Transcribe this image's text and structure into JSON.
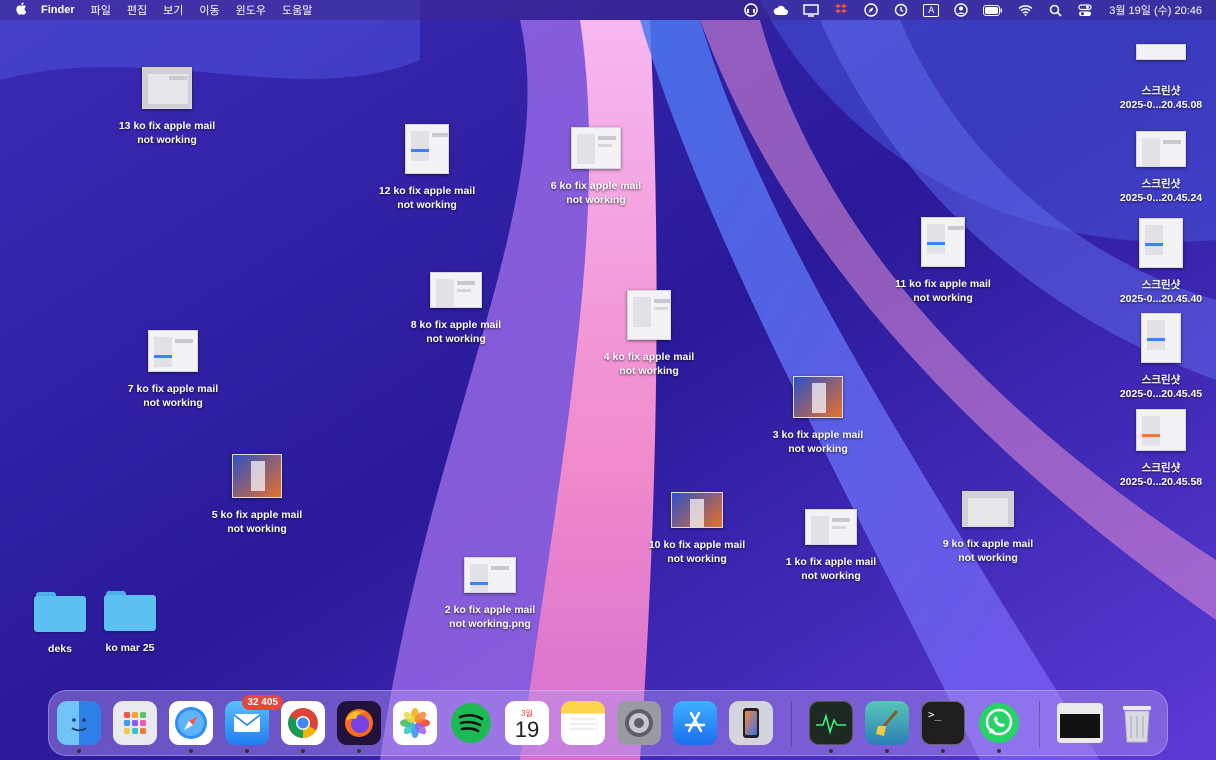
{
  "menubar": {
    "apple": "",
    "app_name": "Finder",
    "menus": [
      "파일",
      "편집",
      "보기",
      "이동",
      "윈도우",
      "도움말"
    ],
    "status_icons": [
      "headset-icon",
      "cloud-icon",
      "display-icon",
      "dropbox-icon",
      "compass-icon",
      "time-machine-icon",
      "input-source-icon",
      "user-icon",
      "battery-icon",
      "wifi-icon",
      "search-icon",
      "control-center-icon"
    ],
    "input_source": "A",
    "clock": "3월 19일 (수) 20:46"
  },
  "desktop": {
    "icons": [
      {
        "line1": "13 ko fix apple mail",
        "line2": "not working"
      },
      {
        "line1": "12 ko fix apple mail",
        "line2": "not working"
      },
      {
        "line1": "6 ko fix apple mail",
        "line2": "not working"
      },
      {
        "line1": "11 ko fix apple mail",
        "line2": "not working"
      },
      {
        "line1": "8 ko fix apple mail",
        "line2": "not working"
      },
      {
        "line1": "4 ko fix apple mail",
        "line2": "not working"
      },
      {
        "line1": "7 ko fix apple mail",
        "line2": "not working"
      },
      {
        "line1": "3 ko fix apple mail",
        "line2": "not working"
      },
      {
        "line1": "5 ko fix apple mail",
        "line2": "not working"
      },
      {
        "line1": "10 ko fix apple mail",
        "line2": "not working"
      },
      {
        "line1": "1 ko fix apple mail",
        "line2": "not working"
      },
      {
        "line1": "9 ko fix apple mail",
        "line2": "not working"
      },
      {
        "line1": "2 ko fix apple mail",
        "line2": "not working.png"
      }
    ],
    "screenshots": [
      {
        "line1": "스크린샷",
        "line2": "2025-0...20.45.08"
      },
      {
        "line1": "스크린샷",
        "line2": "2025-0...20.45.24"
      },
      {
        "line1": "스크린샷",
        "line2": "2025-0...20.45.40"
      },
      {
        "line1": "스크린샷",
        "line2": "2025-0...20.45.45"
      },
      {
        "line1": "스크린샷",
        "line2": "2025-0...20.45.58"
      }
    ],
    "folders": [
      {
        "label": "deks"
      },
      {
        "label": "ko mar 25"
      }
    ]
  },
  "dock": {
    "apps": [
      {
        "name": "finder-icon",
        "color": "#3a8ef0",
        "glyph": "☺",
        "running": true
      },
      {
        "name": "launchpad-icon",
        "color": "#e6e6ee",
        "glyph": "▦",
        "running": false
      },
      {
        "name": "safari-icon",
        "color": "#2f8ff5",
        "glyph": "⊘",
        "running": true
      },
      {
        "name": "mail-icon",
        "color": "#3da0f5",
        "glyph": "✉",
        "running": true
      },
      {
        "name": "chrome-icon",
        "color": "#ffffff",
        "glyph": "◉",
        "running": true
      },
      {
        "name": "firefox-icon",
        "color": "#20123a",
        "glyph": "◐",
        "running": true
      },
      {
        "name": "photos-icon",
        "color": "#ffffff",
        "glyph": "✿",
        "running": false
      },
      {
        "name": "spotify-icon",
        "color": "#1db954",
        "glyph": "≋",
        "running": false
      },
      {
        "name": "calendar-icon",
        "color": "#ffffff",
        "glyph": "",
        "running": false
      },
      {
        "name": "notes-icon",
        "color": "#fbd44a",
        "glyph": "≡",
        "running": false
      },
      {
        "name": "system-settings-icon",
        "color": "#8a8a90",
        "glyph": "⚙",
        "running": false
      },
      {
        "name": "app-store-icon",
        "color": "#1f8cf2",
        "glyph": "A",
        "running": false
      },
      {
        "name": "iphone-mirroring-icon",
        "color": "#c9c9d2",
        "glyph": "▯",
        "running": false
      },
      {
        "name": "activity-monitor-icon",
        "color": "#1d2a22",
        "glyph": "∿",
        "running": true
      },
      {
        "name": "cleanmymac-icon",
        "color": "#3aa4a0",
        "glyph": "⟋",
        "running": true
      },
      {
        "name": "terminal-icon",
        "color": "#1e1e1e",
        "glyph": ">_",
        "running": true
      },
      {
        "name": "whatsapp-icon",
        "color": "#25d366",
        "glyph": "✆",
        "running": true
      }
    ],
    "mail_badge": "32 405",
    "calendar_month": "3월",
    "calendar_day": "19"
  }
}
